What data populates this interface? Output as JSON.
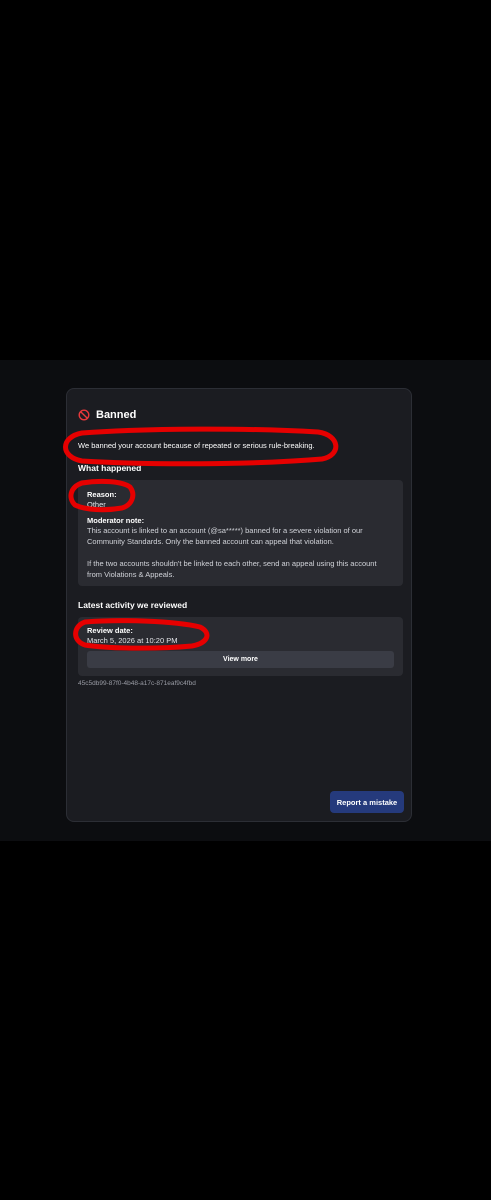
{
  "header": {
    "title": "Banned",
    "icon": "ban-icon"
  },
  "summary": "We banned your account because of repeated or serious rule-breaking.",
  "what_happened": {
    "heading": "What happened",
    "reason_label": "Reason:",
    "reason_value": "Other",
    "note_label": "Moderator note:",
    "note_line1": "This account is linked to an account (@sa*****) banned for a severe violation of our",
    "note_line2": "Community Standards. Only the banned account can appeal that violation.",
    "note_line3": "If the two accounts shouldn't be linked to each other, send an appeal using this account",
    "note_line4": "from Violations & Appeals."
  },
  "latest_activity": {
    "heading": "Latest activity we reviewed",
    "review_label": "Review date:",
    "review_value": "March 5, 2026 at 10:20 PM",
    "view_more_label": "View more"
  },
  "reference_id": "45c5db99-87f0-4b48-a17c-871eaf9c4fbd",
  "actions": {
    "report_label": "Report a mistake"
  },
  "colors": {
    "background": "#000000",
    "card": "#1b1c21",
    "panel": "#2a2b31",
    "accent_button": "#253a7c",
    "ban_icon": "#e8383b",
    "annotation": "#e60000"
  }
}
